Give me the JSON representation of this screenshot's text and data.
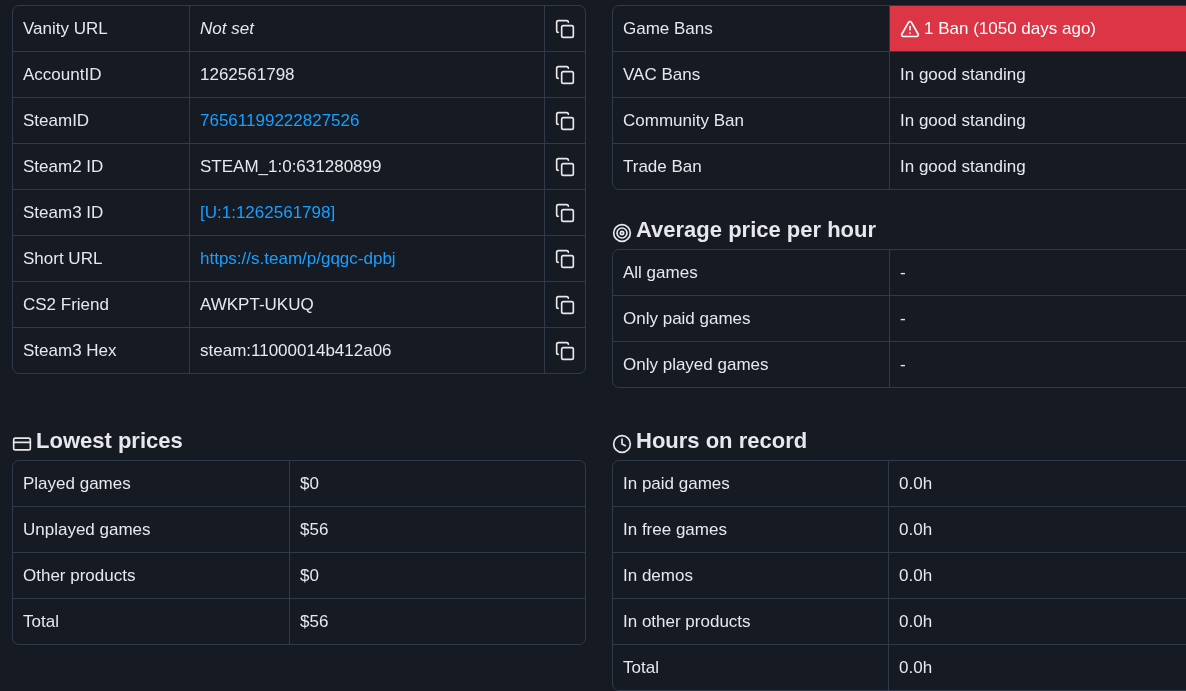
{
  "identifiers": {
    "rows": [
      {
        "label": "Vanity URL",
        "value": "Not set",
        "kind": "unset"
      },
      {
        "label": "AccountID",
        "value": "1262561798",
        "kind": "text"
      },
      {
        "label": "SteamID",
        "value": "76561199222827526",
        "kind": "link"
      },
      {
        "label": "Steam2 ID",
        "value": "STEAM_1:0:631280899",
        "kind": "text"
      },
      {
        "label": "Steam3 ID",
        "value": "[U:1:1262561798]",
        "kind": "link"
      },
      {
        "label": "Short URL",
        "value": "https://s.team/p/gqgc-dpbj",
        "kind": "link"
      },
      {
        "label": "CS2 Friend",
        "value": "AWKPT-UKUQ",
        "kind": "text"
      },
      {
        "label": "Steam3 Hex",
        "value": "steam:11000014b412a06",
        "kind": "text"
      }
    ]
  },
  "bans": {
    "rows": [
      {
        "label": "Game Bans",
        "value": "1 Ban (1050 days ago)",
        "banned": true
      },
      {
        "label": "VAC Bans",
        "value": "In good standing",
        "banned": false
      },
      {
        "label": "Community Ban",
        "value": "In good standing",
        "banned": false
      },
      {
        "label": "Trade Ban",
        "value": "In good standing",
        "banned": false
      }
    ]
  },
  "average_price": {
    "title": "Average price per hour",
    "rows": [
      {
        "label": "All games",
        "value": "-"
      },
      {
        "label": "Only paid games",
        "value": "-"
      },
      {
        "label": "Only played games",
        "value": "-"
      }
    ]
  },
  "lowest_prices": {
    "title": "Lowest prices",
    "rows": [
      {
        "label": "Played games",
        "value": "$0"
      },
      {
        "label": "Unplayed games",
        "value": "$56"
      },
      {
        "label": "Other products",
        "value": "$0"
      },
      {
        "label": "Total",
        "value": "$56"
      }
    ]
  },
  "hours_on_record": {
    "title": "Hours on record",
    "rows": [
      {
        "label": "In paid games",
        "value": "0.0h"
      },
      {
        "label": "In free games",
        "value": "0.0h"
      },
      {
        "label": "In demos",
        "value": "0.0h"
      },
      {
        "label": "In other products",
        "value": "0.0h"
      },
      {
        "label": "Total",
        "value": "0.0h"
      }
    ]
  }
}
